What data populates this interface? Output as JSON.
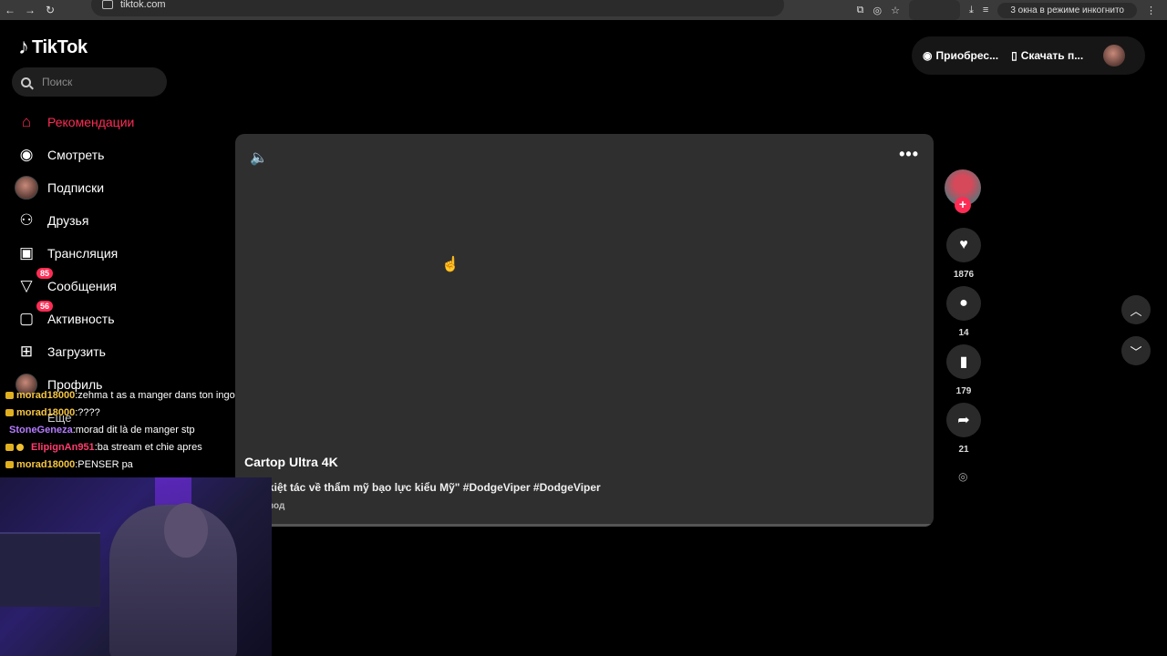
{
  "browser": {
    "url": "tiktok.com",
    "incognito_label": "3 окна в режиме инкогнито"
  },
  "logo": {
    "text": "TikTok"
  },
  "search": {
    "placeholder": "Поиск"
  },
  "nav": {
    "items": [
      {
        "label": "Рекомендации",
        "icon": "home-icon",
        "active": true
      },
      {
        "label": "Смотреть",
        "icon": "compass-icon"
      },
      {
        "label": "Подписки",
        "icon": "following-avatar-icon"
      },
      {
        "label": "Друзья",
        "icon": "friends-icon"
      },
      {
        "label": "Трансляция",
        "icon": "live-tv-icon"
      },
      {
        "label": "Сообщения",
        "icon": "messages-icon",
        "badge": "85"
      },
      {
        "label": "Активность",
        "icon": "activity-icon",
        "badge": "56"
      },
      {
        "label": "Загрузить",
        "icon": "upload-icon"
      },
      {
        "label": "Профиль",
        "icon": "profile-avatar-icon"
      }
    ],
    "more_label": "Еще"
  },
  "top_right": {
    "coins_label": "Приобрес...",
    "download_label": "Скачать п..."
  },
  "video": {
    "author": "Cartop Ultra 4K",
    "description": "kiệt tác về thẩm mỹ bạo lực kiểu Mỹ\" #DodgeViper #DodgeViper",
    "translate_label": "вод"
  },
  "actions": {
    "likes": "1876",
    "comments": "14",
    "saves": "179",
    "shares": "21"
  },
  "chat": [
    {
      "user": "morad18000",
      "message": ":zehma t as a manger dans ton ingo",
      "color_class": "a"
    },
    {
      "user": "morad18000",
      "message": ":????",
      "color_class": "a"
    },
    {
      "user": "StoneGeneza",
      "message": ":morad dit là de manger stp",
      "color_class": "b"
    },
    {
      "user": "ElipignAn951",
      "message": ":ba stream et chie apres",
      "color_class": "c"
    },
    {
      "user": "morad18000",
      "message": ":PENSER pa",
      "color_class": "a"
    }
  ]
}
